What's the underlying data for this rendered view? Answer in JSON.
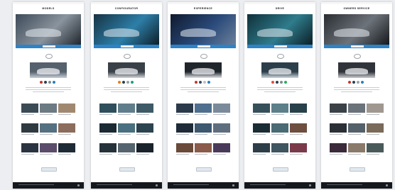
{
  "pages": [
    {
      "title": "MODELS",
      "hero_colors": [
        "#3d4a58",
        "#8a949e",
        "#1f252c"
      ],
      "hero_caption": "",
      "feature_colors": [
        "#55616d",
        "#c7ced6"
      ],
      "dot_colors": [
        "#c0392b",
        "#2c3e50",
        "#7f8c8d",
        "#2980b9"
      ],
      "tile_colors": [
        "#3b4b55",
        "#6c7a82",
        "#a08870",
        "#2f3a40",
        "#557080",
        "#8c6c5c",
        "#2a3440",
        "#5a4c6a",
        "#1e2a36",
        "#7c6a8a",
        "#4c3a5a",
        "#b8a8a0"
      ]
    },
    {
      "title": "CONFIGURATOR",
      "hero_colors": [
        "#173344",
        "#2d7fa8",
        "#0e1e28"
      ],
      "hero_caption": "",
      "feature_colors": [
        "#3a4048",
        "#d2d6db"
      ],
      "dot_colors": [
        "#e67e22",
        "#2c3e50",
        "#95a5a6",
        "#16a085"
      ],
      "tile_colors": [
        "#2f4f5c",
        "#607d8b",
        "#3e5a66",
        "#1b2a33",
        "#4a6f80",
        "#2c4450",
        "#26323a",
        "#55646e",
        "#1a232b",
        "#3c4a52",
        "#6a7880",
        "#222c34"
      ]
    },
    {
      "title": "EXPERIENCE",
      "hero_colors": [
        "#0f1a2e",
        "#2a4a7a",
        "#6b7f9a"
      ],
      "hero_caption": "",
      "feature_colors": [
        "#20252c",
        "#e2e5e9"
      ],
      "dot_colors": [
        "#c0392b",
        "#34495e",
        "#bdc3c7",
        "#2980b9"
      ],
      "tile_colors": [
        "#2b3a4a",
        "#4f6f8f",
        "#7a8a9a",
        "#1f2b38",
        "#3e5870",
        "#5e6e7e",
        "#6a4a3a",
        "#8a5a4a",
        "#4a3a5a",
        "#2a3a2a",
        "#7a6a4a",
        "#3a4a5a"
      ]
    },
    {
      "title": "DRIVE",
      "hero_colors": [
        "#10303a",
        "#2f7c8c",
        "#0b1f26"
      ],
      "hero_caption": "",
      "feature_colors": [
        "#2c3e4a",
        "#d0d8de"
      ],
      "dot_colors": [
        "#e74c3c",
        "#2c3e50",
        "#7f8c8d",
        "#27ae60"
      ],
      "tile_colors": [
        "#35505a",
        "#5c7f8a",
        "#28404a",
        "#1a2c34",
        "#4a6a74",
        "#6e4e3e",
        "#2e3e48",
        "#3f5560",
        "#7a3a4a",
        "#5a2a5a",
        "#1e1e2e",
        "#4a5a6a"
      ]
    },
    {
      "title": "OWNERS SERVICE",
      "hero_colors": [
        "#2a2e33",
        "#6d737a",
        "#15181c"
      ],
      "hero_caption": "",
      "feature_colors": [
        "#30343a",
        "#c9cdd2"
      ],
      "dot_colors": [
        "#c0392b",
        "#2c3e50",
        "#95a5a6",
        "#2980b9"
      ],
      "tile_colors": [
        "#3a4248",
        "#6a727a",
        "#a09890",
        "#2a3036",
        "#54606a",
        "#7a6a5a",
        "#3a2a3a",
        "#8a7a6a",
        "#4a5a5a",
        "#2a3a40",
        "#6a5a4a",
        "#b0a89a"
      ]
    }
  ]
}
